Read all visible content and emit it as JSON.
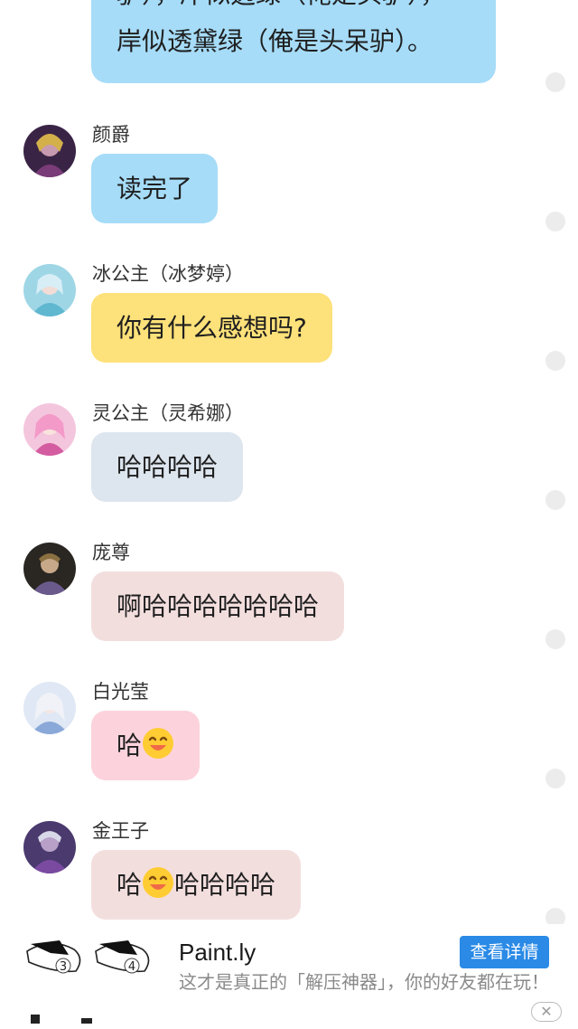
{
  "top_message": {
    "lines": [
      "驴），岸似透绿（俺是头驴），",
      "岸似透黛绿（俺是头呆驴）。"
    ]
  },
  "messages": [
    {
      "sender": "颜爵",
      "text": "读完了",
      "bubble_color": "#a6dcf8"
    },
    {
      "sender": "冰公主（冰梦婷）",
      "text": "你有什么感想吗?",
      "bubble_color": "#fde17a"
    },
    {
      "sender": "灵公主（灵希娜）",
      "text": "哈哈哈哈",
      "bubble_color": "#dde5ee"
    },
    {
      "sender": "庞尊",
      "text": "啊哈哈哈哈哈哈哈",
      "bubble_color": "#f3dede"
    },
    {
      "sender": "白光莹",
      "text_before": "哈",
      "emoji": "grinning-face-emoji",
      "text_after": "",
      "bubble_color": "#fcd3dc"
    },
    {
      "sender": "金王子",
      "text_before": "哈",
      "emoji": "grinning-face-emoji",
      "text_after": "哈哈哈哈",
      "bubble_color": "#f3dede"
    }
  ],
  "ad": {
    "thumb_numbers": [
      "3",
      "4"
    ],
    "title": "Paint.ly",
    "button_label": "查看详情",
    "description": "这才是真正的「解压神器」，你的好友都在玩！",
    "close_icon": "close-icon",
    "button_color": "#2a8ae6"
  }
}
